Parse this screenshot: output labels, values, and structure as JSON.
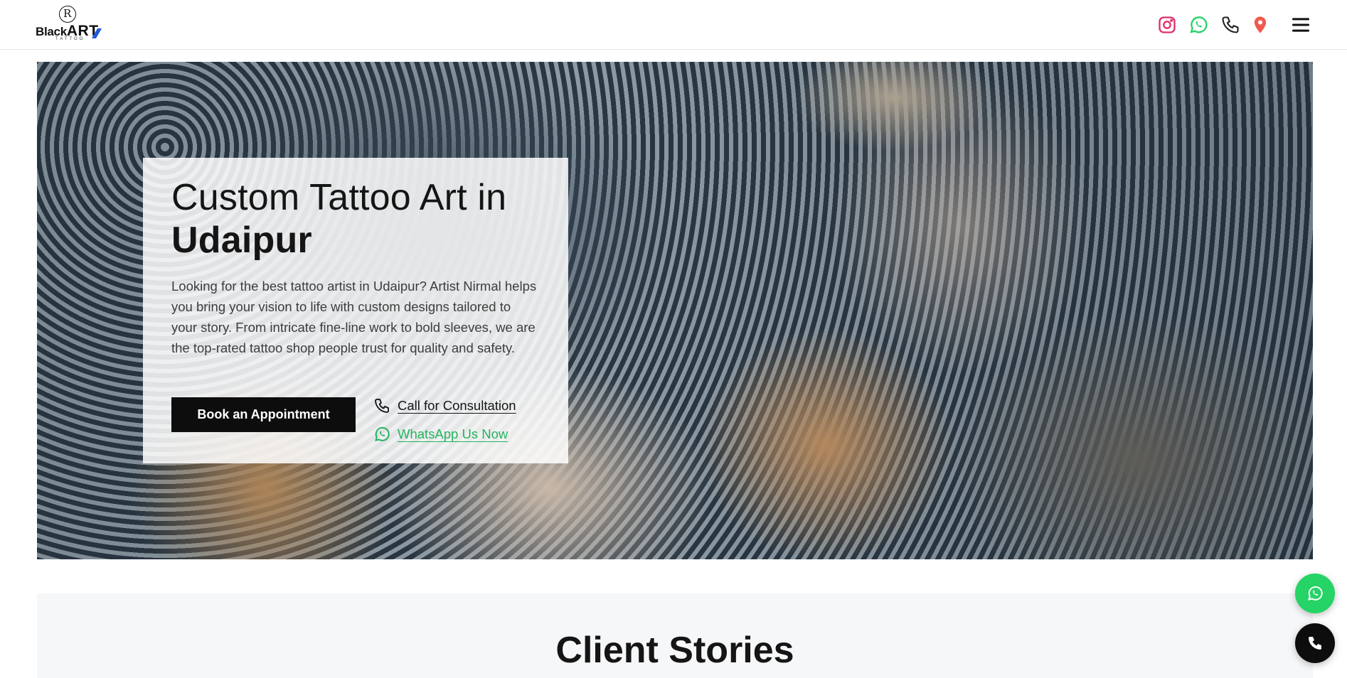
{
  "header": {
    "logo": {
      "word1": "Black",
      "word2": "ART",
      "sub": "TATTOO"
    },
    "icons": [
      "instagram-icon",
      "whatsapp-icon",
      "phone-icon",
      "location-pin-icon",
      "hamburger-menu-icon"
    ]
  },
  "hero": {
    "title_line1": "Custom Tattoo Art in",
    "title_line2": "Udaipur",
    "description": "Looking for the best tattoo artist in Udaipur? Artist Nirmal helps you bring your vision to life with custom designs tailored to your story. From intricate fine-line work to bold sleeves, we are the top-rated tattoo shop people trust for quality and safety.",
    "book_button": "Book an Appointment",
    "call_link": "Call for Consultation",
    "whatsapp_link": "WhatsApp Us Now"
  },
  "stories": {
    "title_bold": "Client",
    "title_rest": " Stories"
  },
  "colors": {
    "whatsapp": "#25D366",
    "whatsapp_link": "#25B35E",
    "instagram": "#E1306C",
    "location": "#F05A4F",
    "dark": "#0D0D0D"
  }
}
